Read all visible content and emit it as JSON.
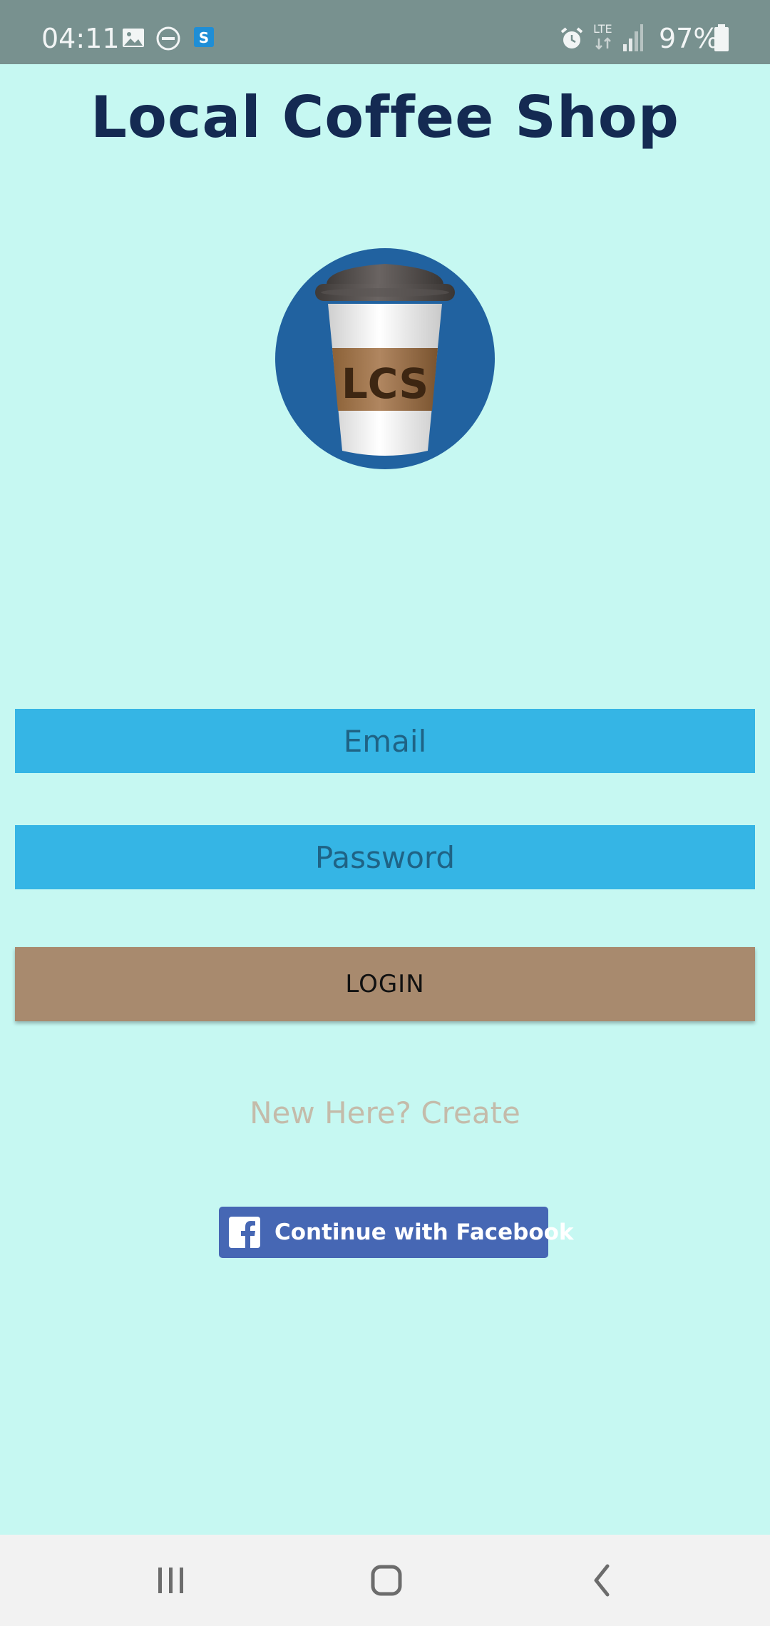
{
  "status_bar": {
    "time": "04:11",
    "battery": "97%",
    "network": "LTE"
  },
  "title": "Local Coffee Shop",
  "logo_text": "LCS",
  "login_form": {
    "email_placeholder": "Email",
    "password_placeholder": "Password",
    "login_label": "LOGIN"
  },
  "create_link": "New Here? Create",
  "facebook_label": "Continue with Facebook",
  "colors": {
    "background": "#c6f8f2",
    "status_bar": "#78918f",
    "input": "#35b5e5",
    "login_button": "#a88a6e",
    "facebook": "#4667b4",
    "title": "#142a52"
  },
  "icons": {
    "status": [
      "image-icon",
      "do-not-disturb-icon",
      "s-app-icon",
      "alarm-icon",
      "signal-icon",
      "battery-icon"
    ],
    "nav": [
      "recent-apps-icon",
      "home-icon",
      "back-icon"
    ]
  }
}
